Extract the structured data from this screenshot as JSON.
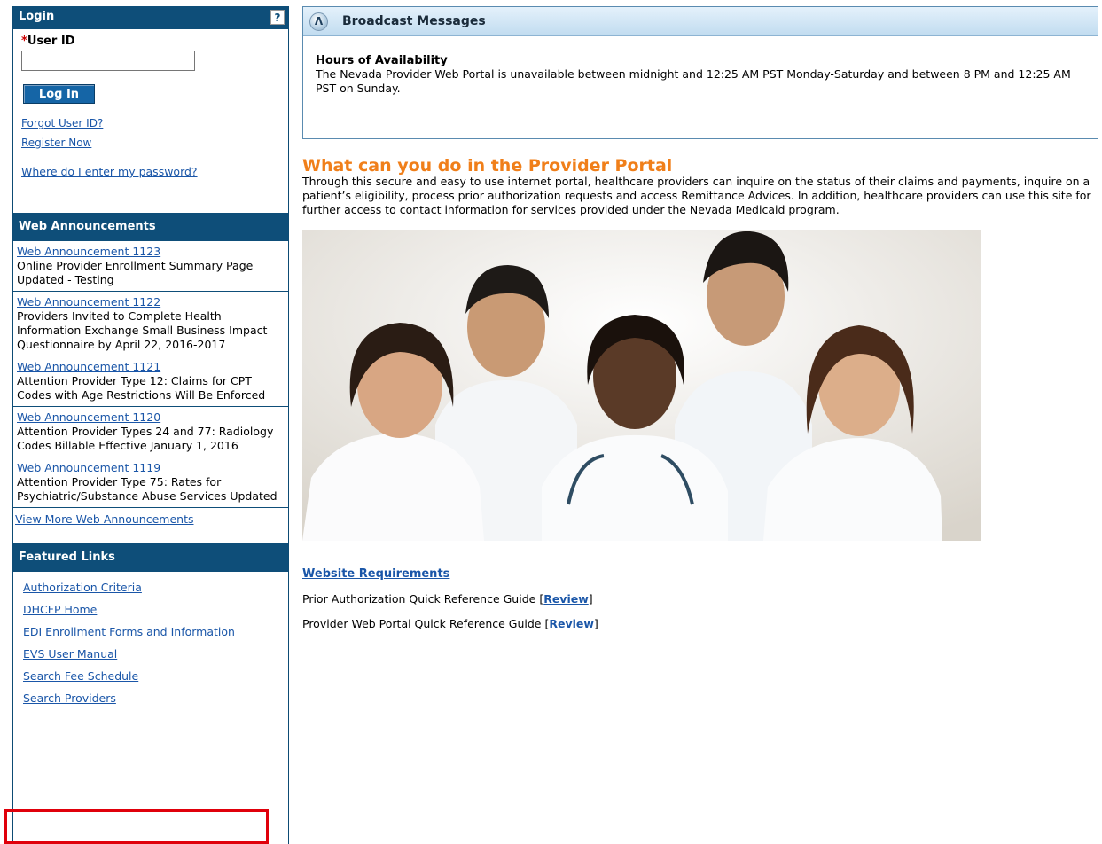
{
  "login": {
    "header": "Login",
    "help": "?",
    "required_mark": "*",
    "user_id_label": "User ID",
    "user_id_value": "",
    "login_button": "Log In",
    "forgot_link": "Forgot User ID?",
    "register_link": "Register Now",
    "password_link": "Where do I enter my password?"
  },
  "announcements": {
    "header": "Web Announcements",
    "items": [
      {
        "title": "Web Announcement 1123",
        "text": "Online Provider Enrollment Summary Page Updated - Testing"
      },
      {
        "title": "Web Announcement 1122",
        "text": "Providers Invited to Complete Health Information Exchange Small Business Impact Questionnaire by April 22, 2016-2017"
      },
      {
        "title": "Web Announcement 1121",
        "text": "Attention Provider Type 12: Claims for CPT Codes with Age Restrictions Will Be Enforced"
      },
      {
        "title": "Web Announcement 1120",
        "text": "Attention Provider Types 24 and 77: Radiology Codes Billable Effective January 1, 2016"
      },
      {
        "title": "Web Announcement 1119",
        "text": "Attention Provider Type 75: Rates for Psychiatric/Substance Abuse Services Updated"
      }
    ],
    "view_more": "View More Web Announcements"
  },
  "featured": {
    "header": "Featured Links",
    "links": [
      "Authorization Criteria",
      "DHCFP Home",
      "EDI Enrollment Forms and Information",
      "EVS User Manual",
      "Search Fee Schedule",
      "Search Providers"
    ]
  },
  "broadcast": {
    "title": "Broadcast Messages",
    "hours_title": "Hours of Availability",
    "hours_text": "The Nevada Provider Web Portal is unavailable between midnight and 12:25 AM PST Monday-Saturday and between 8 PM and 12:25 AM PST on Sunday."
  },
  "portal": {
    "title": "What can you do in the Provider Portal",
    "description": "Through this secure and easy to use internet portal, healthcare providers can inquire on the status of their claims and payments, inquire on a patient’s eligibility, process prior authorization requests and access Remittance Advices. In addition, healthcare providers can use this site for further access to contact information for services provided under the Nevada Medicaid program."
  },
  "requirements": {
    "website_requirements": "Website Requirements",
    "guides": [
      {
        "text": "Prior Authorization Quick Reference Guide",
        "link": "Review"
      },
      {
        "text": "Provider Web Portal Quick Reference Guide",
        "link": "Review"
      }
    ]
  },
  "colors": {
    "sidebar_header": "#0e4e79",
    "portal_title": "#f07f1a",
    "highlight": "#e0000b",
    "link": "#1a56a8"
  }
}
